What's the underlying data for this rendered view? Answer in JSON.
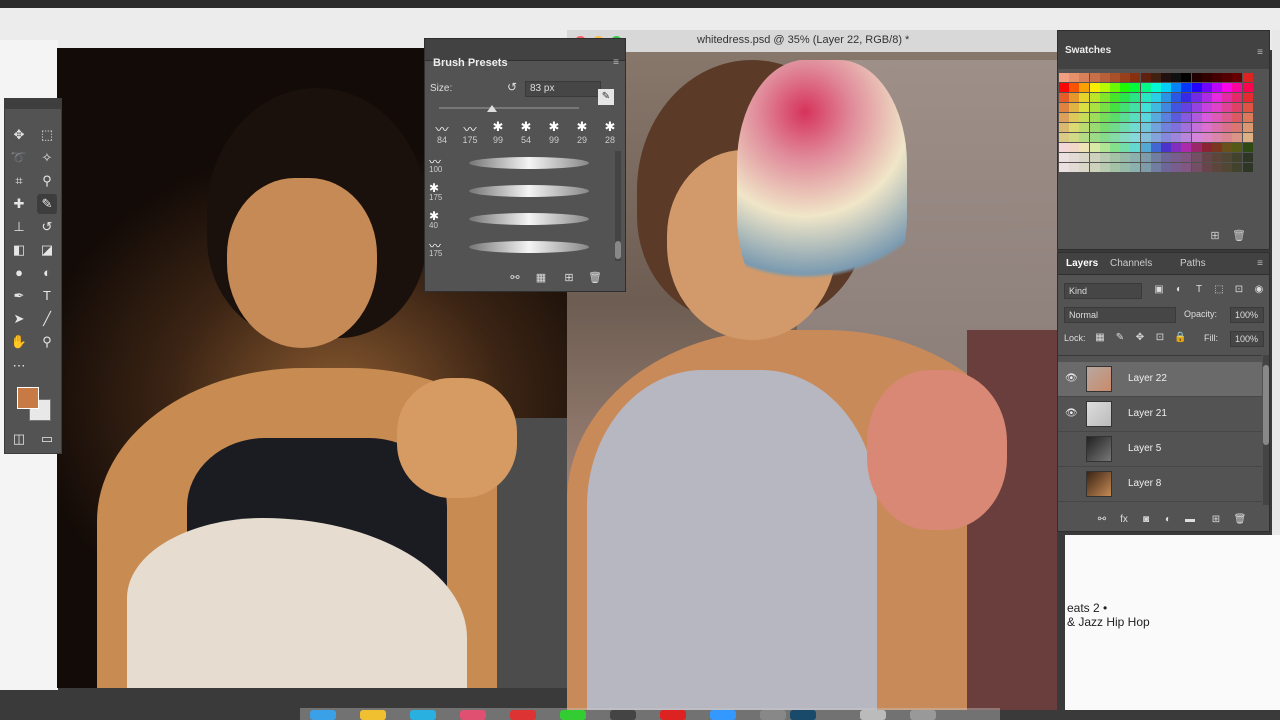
{
  "document": {
    "title": "whitedress.psd @ 35% (Layer 22, RGB/8) *"
  },
  "background_text": {
    "right_line1": "eats 2 •",
    "right_line2": "& Jazz Hip Hop"
  },
  "tools": {
    "items": [
      "move-tool",
      "marquee-tool",
      "lasso-tool",
      "magic-wand-tool",
      "crop-tool",
      "eyedropper-tool",
      "healing-tool",
      "brush-tool",
      "stamp-tool",
      "history-brush-tool",
      "eraser-tool",
      "gradient-tool",
      "blur-tool",
      "dodge-tool",
      "pen-tool",
      "type-tool",
      "path-select-tool",
      "line-tool",
      "hand-tool",
      "zoom-tool"
    ],
    "foreground_color": "#c77a45",
    "background_color": "#e8e8e8"
  },
  "brush_presets": {
    "title": "Brush Presets",
    "size_label": "Size:",
    "size_value": "83 px",
    "tips": [
      {
        "number": "84"
      },
      {
        "number": "175"
      },
      {
        "number": "99"
      },
      {
        "number": "54"
      },
      {
        "number": "99"
      },
      {
        "number": "29"
      },
      {
        "number": "28"
      }
    ],
    "stroke_rows": [
      {
        "number": "100"
      },
      {
        "number": "175"
      },
      {
        "number": "40"
      },
      {
        "number": "175"
      }
    ]
  },
  "swatches": {
    "title": "Swatches"
  },
  "layers": {
    "tabs": [
      "Layers",
      "Channels",
      "Paths"
    ],
    "filter_kind": "Kind",
    "blend_mode": "Normal",
    "opacity_label": "Opacity:",
    "opacity_value": "100%",
    "lock_label": "Lock:",
    "fill_label": "Fill:",
    "fill_value": "100%",
    "items": [
      {
        "name": "Layer 22",
        "selected": true,
        "visible": true
      },
      {
        "name": "Layer 21",
        "selected": false,
        "visible": true
      },
      {
        "name": "Layer 5",
        "selected": false,
        "visible": false
      },
      {
        "name": "Layer 8",
        "selected": false,
        "visible": false
      }
    ]
  },
  "colors": {
    "panel": "#535353",
    "panel_header": "#424242",
    "selected_layer": "#6a6a6a",
    "accent": "#c77a45"
  }
}
